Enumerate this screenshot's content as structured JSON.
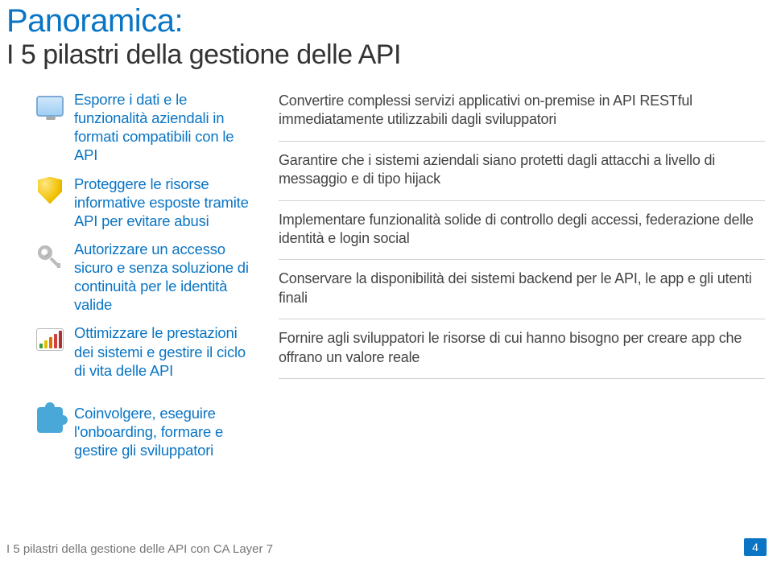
{
  "title": "Panoramica:",
  "subtitle": "I 5 pilastri della gestione delle API",
  "pillars": [
    {
      "label": "Esporre i dati e le funzionalità aziendali in formati compatibili con le API",
      "desc": "Convertire complessi servizi applicativi on-premise in API RESTful immediatamente utilizzabili dagli sviluppatori"
    },
    {
      "label": "Proteggere le risorse informative esposte tramite API per evitare abusi",
      "desc": "Garantire che i sistemi aziendali siano protetti dagli attacchi a livello di messaggio e di tipo hijack"
    },
    {
      "label": "Autorizzare un accesso sicuro e senza soluzione di continuità per le identità valide",
      "desc": "Implementare funzionalità solide di controllo degli accessi, federazione delle identità e login social"
    },
    {
      "label": "Ottimizzare le prestazioni dei sistemi e gestire il ciclo di vita delle API",
      "desc": "Conservare la disponibilità dei sistemi backend per le API, le app e gli utenti finali"
    },
    {
      "label": "Coinvolgere, eseguire l'onboarding, formare e gestire gli sviluppatori",
      "desc": "Fornire agli sviluppatori le risorse di cui hanno bisogno per creare app che offrano un valore reale"
    }
  ],
  "footer_text": "I 5 pilastri della gestione delle API con CA Layer 7",
  "page_number": "4"
}
